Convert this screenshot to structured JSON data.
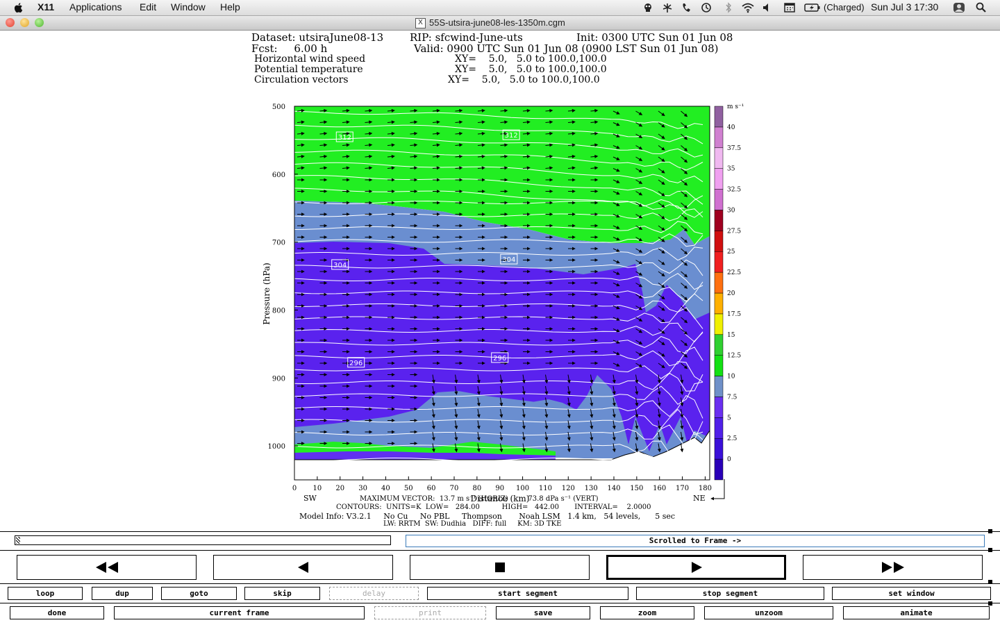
{
  "menubar": {
    "app_name": "X11",
    "items": [
      "Applications",
      "Edit",
      "Window",
      "Help"
    ],
    "battery_status": "(Charged)",
    "clock": "Sun Jul 3  17:30"
  },
  "window": {
    "title": "55S-utsira-june08-les-1350m.cgm"
  },
  "plot_header": {
    "line1_dataset": "Dataset: utsiraJune08-13",
    "line1_rip": "RIP: sfcwind-June-uts",
    "line1_init": "Init: 0300 UTC Sun 01 Jun 08",
    "line2_fcst": "Fcst:     6.00 h",
    "line2_valid": "Valid: 0900 UTC Sun 01 Jun 08 (0900 LST Sun 01 Jun 08)",
    "fields": [
      {
        "name": "Horizontal wind speed",
        "xy": "XY=    5.0,   5.0 to 100.0,100.0"
      },
      {
        "name": "Potential temperature",
        "xy": "XY=    5.0,   5.0 to 100.0,100.0"
      },
      {
        "name": "Circulation vectors",
        "xy": "XY=    5.0,   5.0 to 100.0,100.0"
      }
    ]
  },
  "chart_data": {
    "type": "heatmap",
    "xlabel": "Distance (km)",
    "ylabel": "Pressure (hPa)",
    "x_ticks": [
      "0",
      "10",
      "20",
      "30",
      "40",
      "50",
      "60",
      "70",
      "80",
      "90",
      "100",
      "110",
      "120",
      "130",
      "140",
      "150",
      "160",
      "170",
      "180"
    ],
    "y_ticks": [
      "500",
      "600",
      "700",
      "800",
      "900",
      "1000"
    ],
    "xlim": [
      0,
      182
    ],
    "ylim": [
      1050,
      500
    ],
    "x_end_labels": {
      "left": "SW",
      "right": "NE"
    },
    "contour_labels": [
      {
        "label": "312",
        "x": 22,
        "p": 545
      },
      {
        "label": "312",
        "x": 95,
        "p": 542
      },
      {
        "label": "304",
        "x": 20,
        "p": 733
      },
      {
        "label": "304",
        "x": 94,
        "p": 725
      },
      {
        "label": "296",
        "x": 27,
        "p": 877
      },
      {
        "label": "296",
        "x": 90,
        "p": 870
      }
    ],
    "colorbar": {
      "unit": "m s⁻¹",
      "levels": [
        "0",
        "2.5",
        "5",
        "7.5",
        "10",
        "12.5",
        "15",
        "17.5",
        "20",
        "22.5",
        "25",
        "27.5",
        "30",
        "32.5",
        "35",
        "37.5",
        "40"
      ],
      "colors": [
        "#2a00b8",
        "#3a10d8",
        "#5020e8",
        "#6a2ff0",
        "#6f90c8",
        "#14e014",
        "#30d030",
        "#f0f000",
        "#ffb000",
        "#ff7010",
        "#f02020",
        "#d01010",
        "#a00020",
        "#d070d0",
        "#f0a0f0",
        "#f0b8f0",
        "#d080d0",
        "#9060a0"
      ]
    },
    "bands": [
      {
        "speed_class": "10-12.5",
        "color": "#22ee22"
      },
      {
        "speed_class": "7.5-10",
        "color": "#6a8ed0"
      },
      {
        "speed_class": "5-7.5",
        "color": "#5a22ee"
      },
      {
        "speed_class": "2.5-5",
        "color": "#6030f0"
      }
    ]
  },
  "plot_footer": {
    "max_vector": "MAXIMUM VECTOR:  13.7 m s⁻¹ (HORIZ)         73.8 dPa s⁻¹ (VERT)",
    "contours": "CONTOURS:  UNITS=K  LOW=   284.00          HIGH=   442.00       INTERVAL=    2.0000",
    "model_info": "Model Info: V3.2.1     No Cu     No PBL     Thompson       Noah LSM   1.4 km,   54 levels,      5 sec",
    "physics": "LW: RRTM  SW: Dudhia   DIFF: full     KM: 3D TKE"
  },
  "controls": {
    "scroll_status": "Scrolled to Frame ->",
    "row1": [
      "loop",
      "dup",
      "goto",
      "skip",
      "delay",
      "start segment",
      "stop segment",
      "set window"
    ],
    "row2": [
      "done",
      "current frame",
      "print",
      "save",
      "zoom",
      "unzoom",
      "animate"
    ]
  }
}
